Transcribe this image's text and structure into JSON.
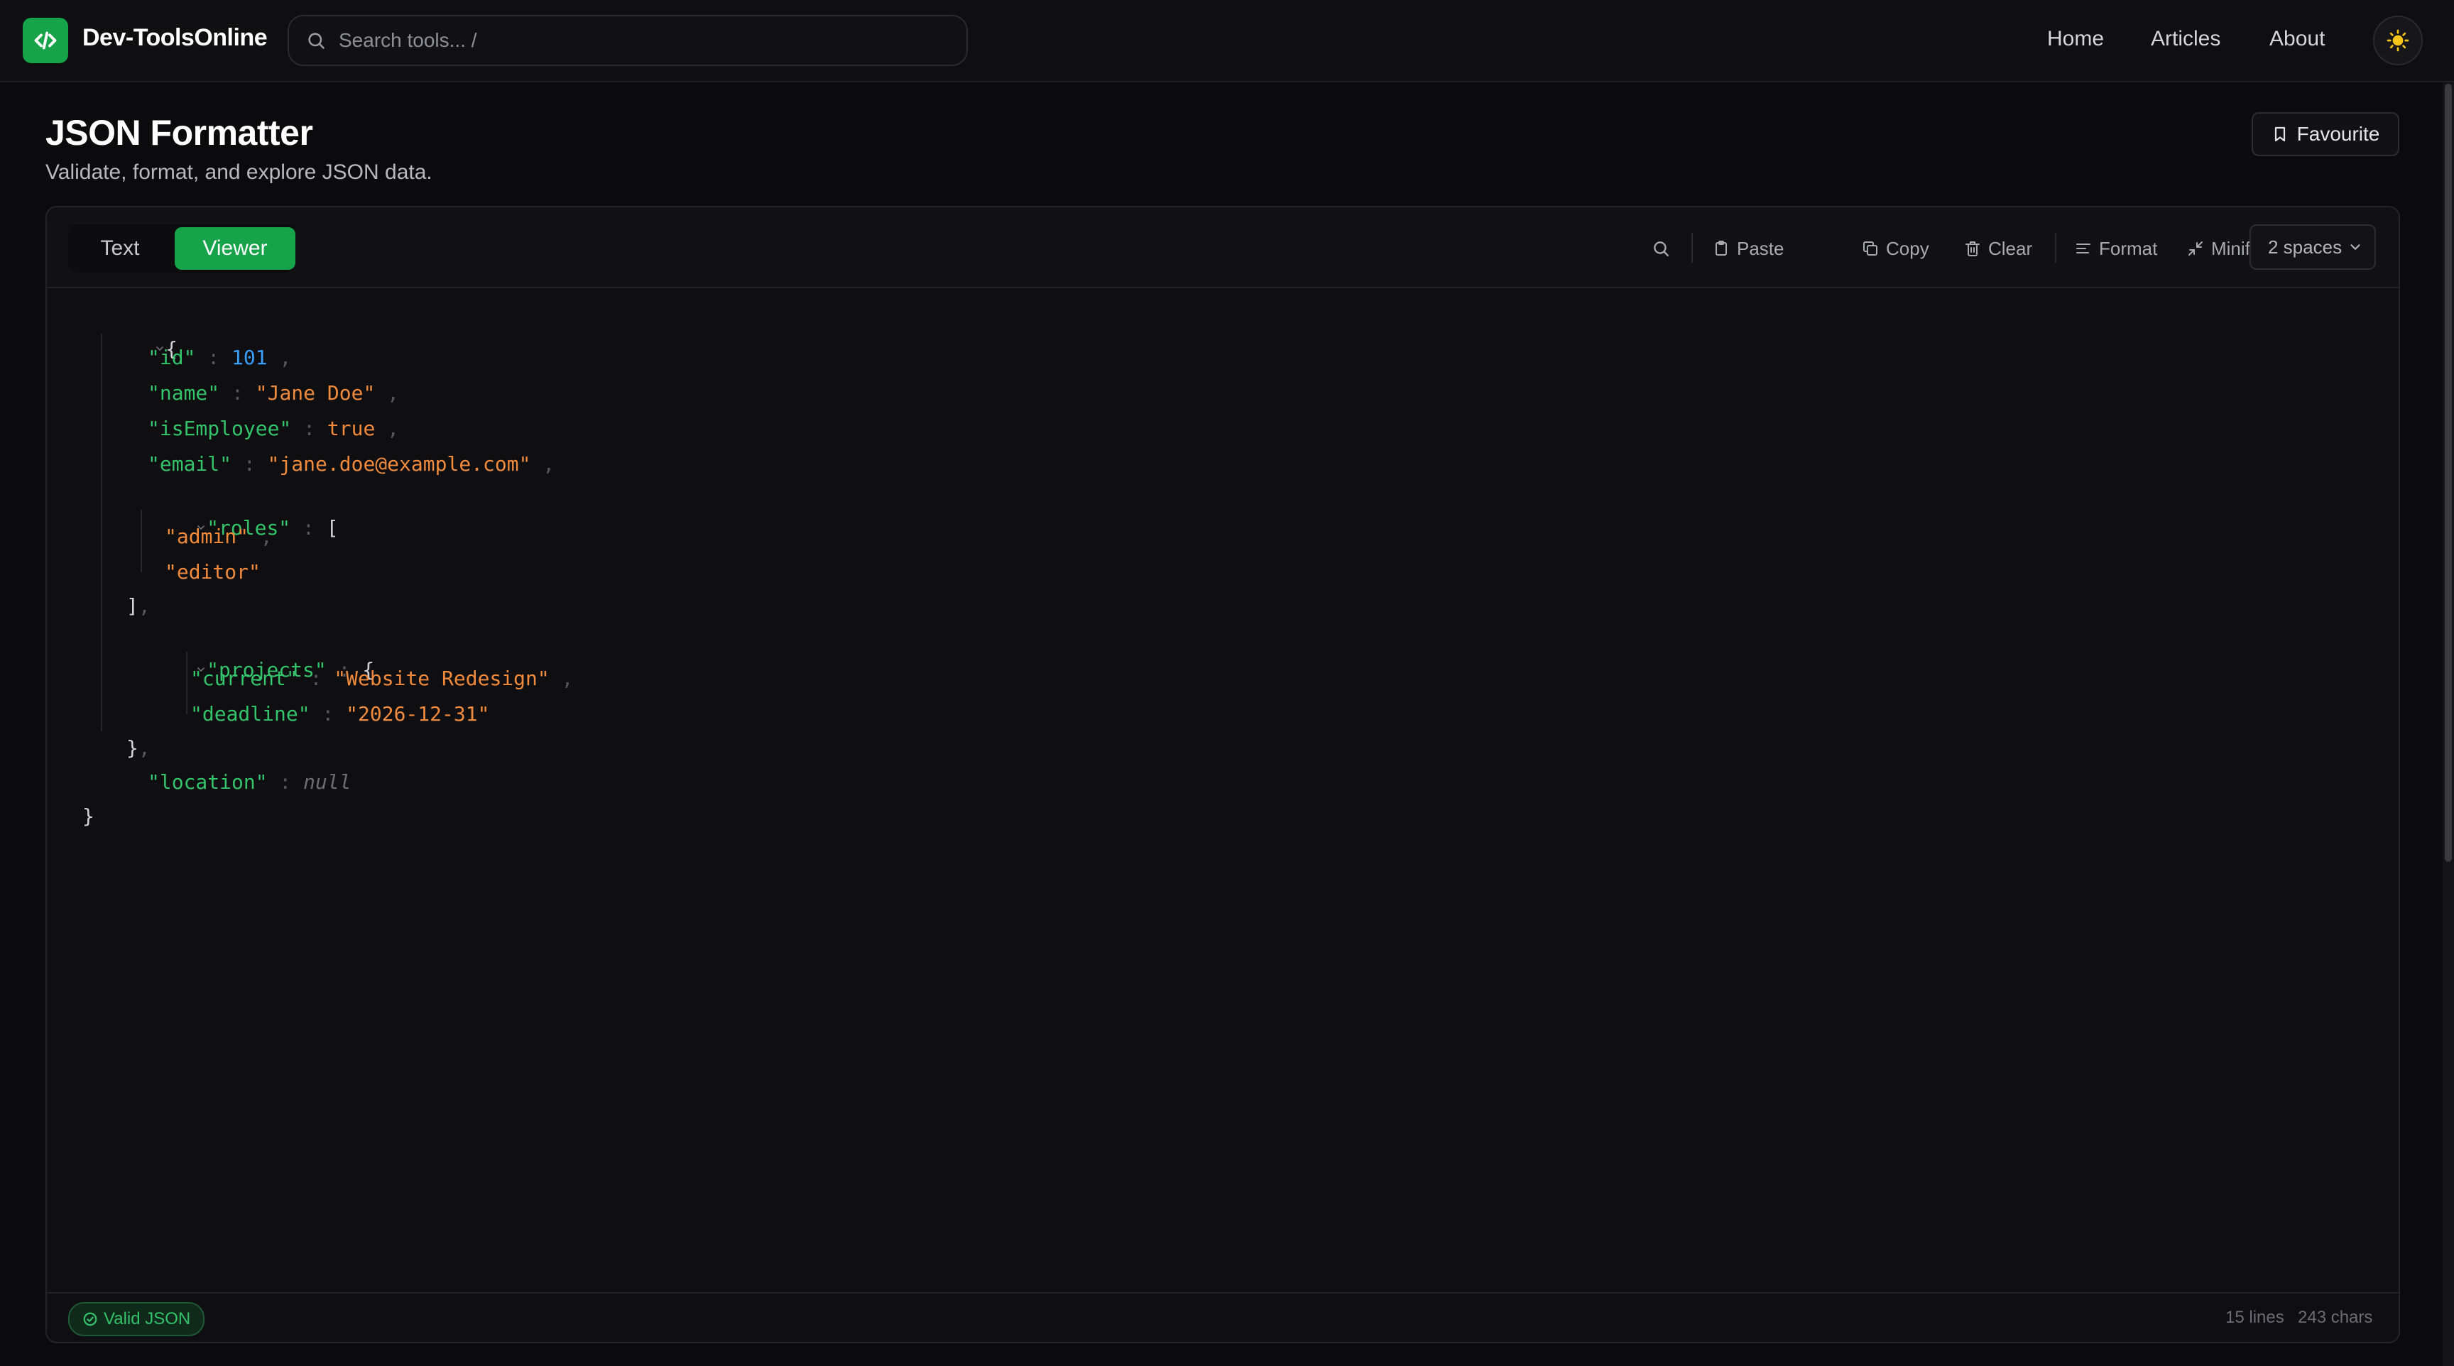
{
  "header": {
    "brand": "Dev-ToolsOnline",
    "search_placeholder": "Search tools... /",
    "nav": [
      "Home",
      "Articles",
      "About"
    ]
  },
  "page": {
    "title": "JSON Formatter",
    "subtitle": "Validate, format, and explore JSON data.",
    "favourite_label": "Favourite"
  },
  "toolbar": {
    "tabs": [
      "Text",
      "Viewer"
    ],
    "active_tab": "Viewer",
    "paste": "Paste",
    "copy": "Copy",
    "clear": "Clear",
    "format": "Format",
    "minify": "Minify",
    "indent": "2 spaces"
  },
  "json_tree": {
    "lines": [
      {
        "key": "",
        "value": "{"
      },
      {
        "key": "\"id\"",
        "value": "101"
      },
      {
        "key": "\"name\"",
        "value": "\"Jane Doe\""
      },
      {
        "key": "\"isEmployee\"",
        "value": "true"
      },
      {
        "key": "\"email\"",
        "value": "\"jane.doe@example.com\""
      },
      {
        "key": "\"roles\"",
        "value": "["
      },
      {
        "key": "",
        "value": "\"admin\""
      },
      {
        "key": "",
        "value": "\"editor\""
      },
      {
        "key": "",
        "value": "]"
      },
      {
        "key": "\"projects\"",
        "value": "{"
      },
      {
        "key": "\"current\"",
        "value": "\"Website Redesign\""
      },
      {
        "key": "\"deadline\"",
        "value": "\"2026-12-31\""
      },
      {
        "key": "",
        "value": "}"
      },
      {
        "key": "\"location\"",
        "value": "null"
      },
      {
        "key": "",
        "value": "}"
      }
    ]
  },
  "status": {
    "valid": "Valid JSON",
    "lines": "15 lines",
    "chars": "243 chars"
  },
  "colors": {
    "accent": "#16a34a",
    "key": "#34c26a",
    "string": "#f08a3c",
    "number": "#3aa0ff"
  }
}
